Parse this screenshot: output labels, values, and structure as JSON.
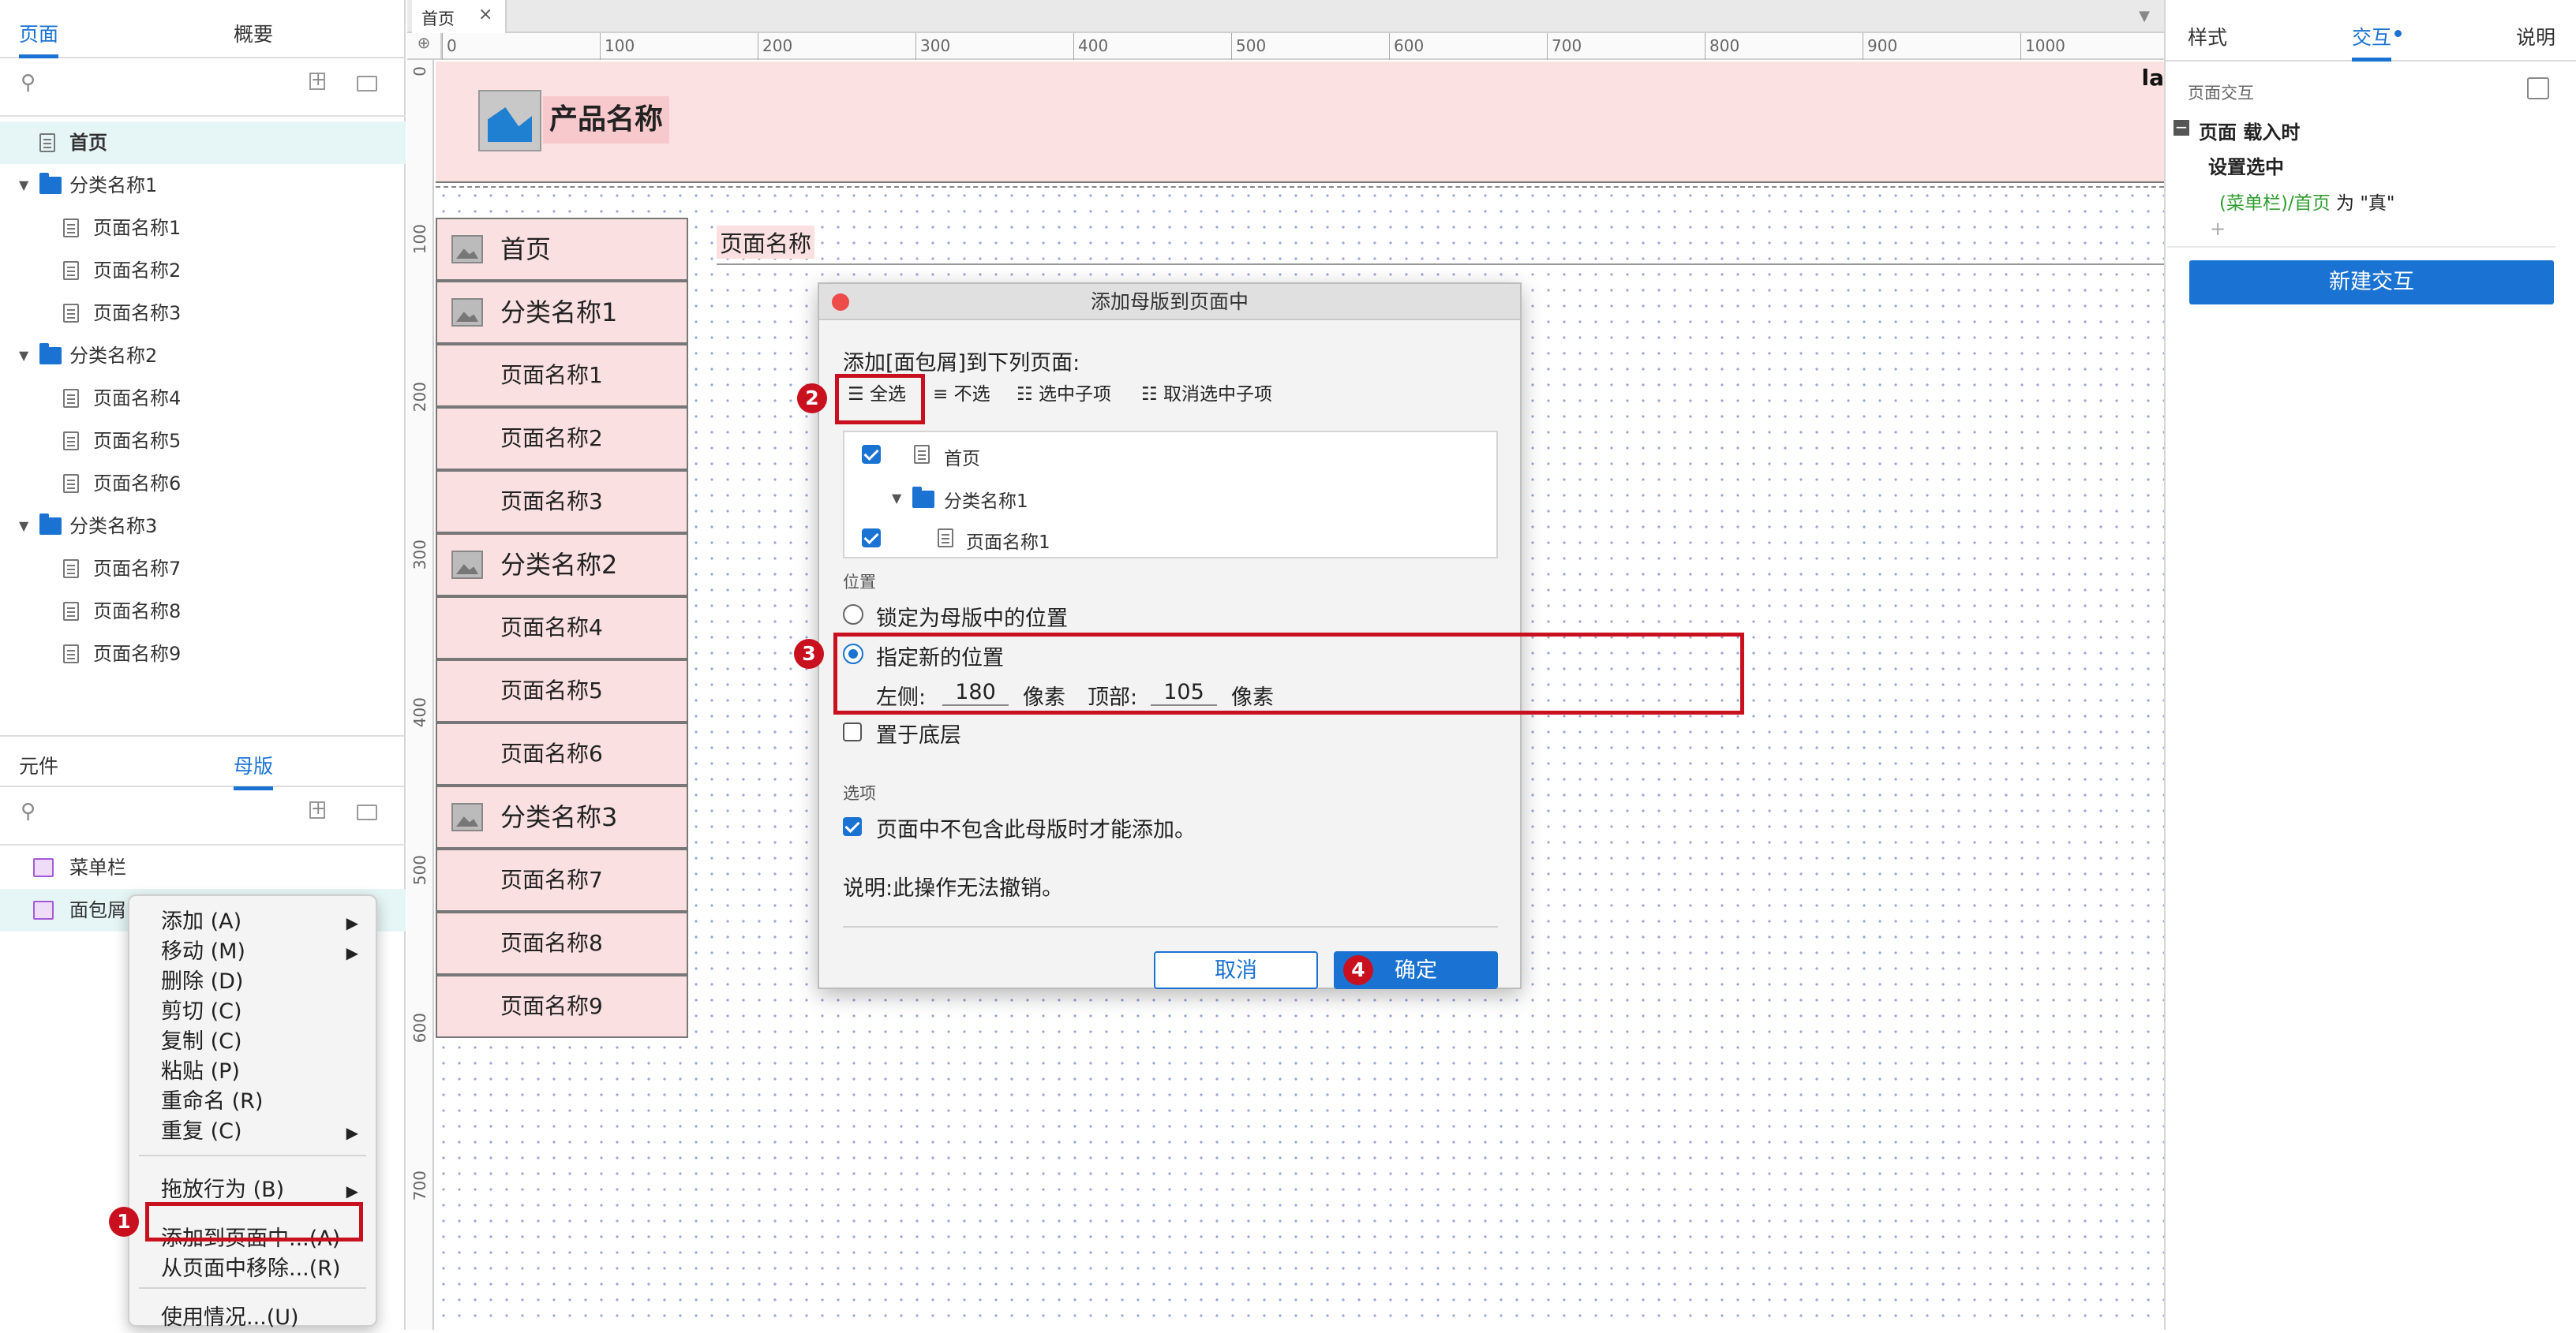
{
  "left": {
    "top_tabs": [
      "页面",
      "概要"
    ],
    "pages": [
      {
        "label": "首页",
        "type": "page",
        "level": 0
      },
      {
        "label": "分类名称1",
        "type": "folder",
        "level": 0
      },
      {
        "label": "页面名称1",
        "type": "page",
        "level": 1
      },
      {
        "label": "页面名称2",
        "type": "page",
        "level": 1
      },
      {
        "label": "页面名称3",
        "type": "page",
        "level": 1
      },
      {
        "label": "分类名称2",
        "type": "folder",
        "level": 0
      },
      {
        "label": "页面名称4",
        "type": "page",
        "level": 1
      },
      {
        "label": "页面名称5",
        "type": "page",
        "level": 1
      },
      {
        "label": "页面名称6",
        "type": "page",
        "level": 1
      },
      {
        "label": "分类名称3",
        "type": "folder",
        "level": 0
      },
      {
        "label": "页面名称7",
        "type": "page",
        "level": 1
      },
      {
        "label": "页面名称8",
        "type": "page",
        "level": 1
      },
      {
        "label": "页面名称9",
        "type": "page",
        "level": 1
      }
    ],
    "bottom_tabs": [
      "元件",
      "母版"
    ],
    "masters": [
      "菜单栏",
      "面包屑"
    ]
  },
  "context_menu": {
    "items": [
      {
        "label": "添加 (A)",
        "submenu": true
      },
      {
        "label": "移动 (M)",
        "submenu": true
      },
      {
        "label": "删除 (D)",
        "submenu": false
      },
      {
        "label": "剪切 (C)",
        "submenu": false
      },
      {
        "label": "复制 (C)",
        "submenu": false
      },
      {
        "label": "粘贴 (P)",
        "submenu": false
      },
      {
        "label": "重命名 (R)",
        "submenu": false
      },
      {
        "label": "重复 (C)",
        "submenu": true
      },
      {
        "label": "拖放行为 (B)",
        "submenu": true
      },
      {
        "label": "添加到页面中...(A)",
        "submenu": false
      },
      {
        "label": "从页面中移除...(R)",
        "submenu": false
      },
      {
        "label": "使用情况...(U)",
        "submenu": false
      }
    ]
  },
  "canvas": {
    "doc_tab": "首页",
    "ruler_h": [
      "0",
      "100",
      "200",
      "300",
      "400",
      "500",
      "600",
      "700",
      "800",
      "900",
      "1000"
    ],
    "ruler_v": [
      "0",
      "100",
      "200",
      "300",
      "400",
      "500",
      "600",
      "700"
    ],
    "product_name": "产品名称",
    "header_cut_text": "la",
    "breadcrumb_label": "页面名称",
    "nav_items": [
      {
        "label": "首页",
        "icon": true
      },
      {
        "label": "分类名称1",
        "icon": true
      },
      {
        "label": "页面名称1",
        "icon": false
      },
      {
        "label": "页面名称2",
        "icon": false
      },
      {
        "label": "页面名称3",
        "icon": false
      },
      {
        "label": "分类名称2",
        "icon": true
      },
      {
        "label": "页面名称4",
        "icon": false
      },
      {
        "label": "页面名称5",
        "icon": false
      },
      {
        "label": "页面名称6",
        "icon": false
      },
      {
        "label": "分类名称3",
        "icon": true
      },
      {
        "label": "页面名称7",
        "icon": false
      },
      {
        "label": "页面名称8",
        "icon": false
      },
      {
        "label": "页面名称9",
        "icon": false
      }
    ]
  },
  "dialog": {
    "title": "添加母版到页面中",
    "prompt": "添加[面包屑]到下列页面:",
    "toolbar": [
      "全选",
      "不选",
      "选中子项",
      "取消选中子项"
    ],
    "tree": [
      {
        "label": "首页",
        "checked": true
      },
      {
        "label": "分类名称1",
        "checked": null
      },
      {
        "label": "页面名称1",
        "checked": true
      }
    ],
    "position_section": "位置",
    "radio_lock": "锁定为母版中的位置",
    "radio_new": "指定新的位置",
    "left_label": "左侧:",
    "left_value": "180",
    "unit": "像素",
    "top_label": "顶部:",
    "top_value": "105",
    "bottom_layer": "置于底层",
    "options_section": "选项",
    "option_only_if_missing": "页面中不包含此母版时才能添加。",
    "note": "说明:此操作无法撤销。",
    "cancel": "取消",
    "ok": "确定"
  },
  "badges": [
    "1",
    "2",
    "3",
    "4"
  ],
  "right": {
    "tabs": [
      "样式",
      "交互",
      "说明"
    ],
    "section_title": "页面交互",
    "event": "页面 载入时",
    "action": "设置选中",
    "target_prefix": "(菜单栏)/首页",
    "target_suffix": " 为 \"真\"",
    "add": "+",
    "new_button": "新建交互"
  },
  "colors": {
    "accent": "#1a73d2",
    "highlight_red": "#c9101e",
    "canvas_pink": "#fbe0e1",
    "selected_row": "#e6f5f5"
  }
}
